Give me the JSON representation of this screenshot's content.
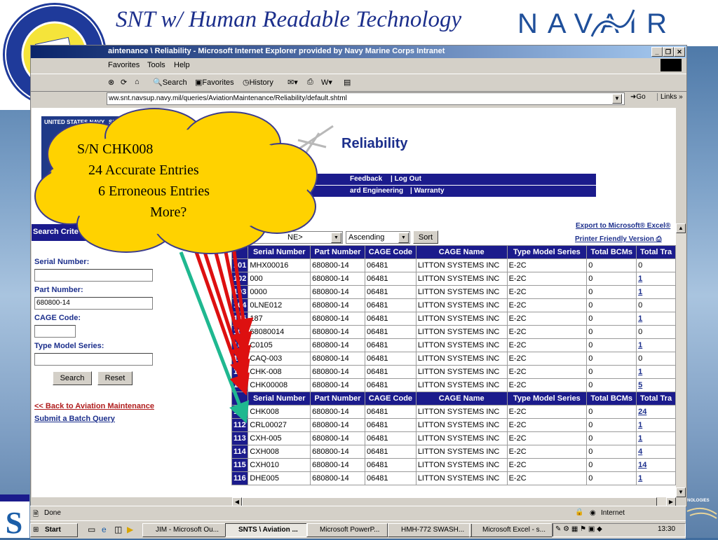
{
  "slide": {
    "title": "SNT w/ Human Readable Technology",
    "brand": "NAVAIR",
    "right_logo_text": "NOLOGIES"
  },
  "seal": {
    "top_text": "ASSISTANT SECRETARY OF THE NAVY",
    "bottom_text": "RESEARCH, DEVELOPMENT AND ACQUISITION"
  },
  "callout": {
    "line1": "S/N CHK008",
    "line2": "24 Accurate Entries",
    "line3": "6 Erroneous Entries",
    "line4": "More?"
  },
  "window": {
    "title": "aintenance \\ Reliability - Microsoft Internet Explorer provided by Navy Marine Corps Intranet",
    "menu": [
      "Favorites",
      "Tools",
      "Help"
    ],
    "toolbar": {
      "search": "Search",
      "favorites": "Favorites",
      "history": "History"
    },
    "address": "ww.snt.navsup.navy.mil/queries/AviationMaintenance/Reliability/default.shtml",
    "go": "Go",
    "links": "Links"
  },
  "page": {
    "logo_text": "UNITED STATES NAVY",
    "logo_sub": "SERI",
    "heading": "Reliability",
    "nav1": [
      "Feedback",
      "| Log Out"
    ],
    "nav2": [
      "ard Engineering",
      "| Warranty"
    ],
    "criteria_title": "Search Crite",
    "serial_label": "Serial Number:",
    "serial_value": "",
    "part_label": "Part Number:",
    "part_value": "680800-14",
    "cage_label": "CAGE Code:",
    "cage_value": "",
    "tms_label": "Type Model Series:",
    "tms_value": "",
    "search_btn": "Search",
    "reset_btn": "Reset",
    "back_link": "<< Back to Aviation Maintenance",
    "batch_link": "Submit a Batch Query",
    "sort_field": "NE>",
    "sort_order": "Ascending",
    "sort_btn": "Sort",
    "export_link": "Export to Microsoft® Excel®",
    "print_link": "Printer Friendly Version"
  },
  "table": {
    "headers": [
      "Serial Number",
      "Part Number",
      "CAGE Code",
      "CAGE Name",
      "Type Model Series",
      "Total BCMs",
      "Total Tra"
    ],
    "rows": [
      {
        "n": "101",
        "sn": "MHX00016",
        "pn": "680800-14",
        "cage": "06481",
        "name": "LITTON SYSTEMS INC",
        "tms": "E-2C",
        "bcm": "0",
        "tra": "0",
        "link": false
      },
      {
        "n": "102",
        "sn": "000",
        "pn": "680800-14",
        "cage": "06481",
        "name": "LITTON SYSTEMS INC",
        "tms": "E-2C",
        "bcm": "0",
        "tra": "1",
        "link": true
      },
      {
        "n": "103",
        "sn": "0000",
        "pn": "680800-14",
        "cage": "06481",
        "name": "LITTON SYSTEMS INC",
        "tms": "E-2C",
        "bcm": "0",
        "tra": "1",
        "link": true
      },
      {
        "n": "104",
        "sn": "0LNE012",
        "pn": "680800-14",
        "cage": "06481",
        "name": "LITTON SYSTEMS INC",
        "tms": "E-2C",
        "bcm": "0",
        "tra": "0",
        "link": false
      },
      {
        "n": "105",
        "sn": "187",
        "pn": "680800-14",
        "cage": "06481",
        "name": "LITTON SYSTEMS INC",
        "tms": "E-2C",
        "bcm": "0",
        "tra": "1",
        "link": true
      },
      {
        "n": "106",
        "sn": "68080014",
        "pn": "680800-14",
        "cage": "06481",
        "name": "LITTON SYSTEMS INC",
        "tms": "E-2C",
        "bcm": "0",
        "tra": "0",
        "link": false
      },
      {
        "n": "107",
        "sn": "C0105",
        "pn": "680800-14",
        "cage": "06481",
        "name": "LITTON SYSTEMS INC",
        "tms": "E-2C",
        "bcm": "0",
        "tra": "1",
        "link": true
      },
      {
        "n": "108",
        "sn": "CAQ-003",
        "pn": "680800-14",
        "cage": "06481",
        "name": "LITTON SYSTEMS INC",
        "tms": "E-2C",
        "bcm": "0",
        "tra": "0",
        "link": false
      },
      {
        "n": "109",
        "sn": "CHK-008",
        "pn": "680800-14",
        "cage": "06481",
        "name": "LITTON SYSTEMS INC",
        "tms": "E-2C",
        "bcm": "0",
        "tra": "1",
        "link": true
      },
      {
        "n": "110",
        "sn": "CHK00008",
        "pn": "680800-14",
        "cage": "06481",
        "name": "LITTON SYSTEMS INC",
        "tms": "E-2C",
        "bcm": "0",
        "tra": "5",
        "link": true
      },
      {
        "n": "",
        "header": true
      },
      {
        "n": "111",
        "sn": "CHK008",
        "pn": "680800-14",
        "cage": "06481",
        "name": "LITTON SYSTEMS INC",
        "tms": "E-2C",
        "bcm": "0",
        "tra": "24",
        "link": true
      },
      {
        "n": "112",
        "sn": "CRL00027",
        "pn": "680800-14",
        "cage": "06481",
        "name": "LITTON SYSTEMS INC",
        "tms": "E-2C",
        "bcm": "0",
        "tra": "1",
        "link": true
      },
      {
        "n": "113",
        "sn": "CXH-005",
        "pn": "680800-14",
        "cage": "06481",
        "name": "LITTON SYSTEMS INC",
        "tms": "E-2C",
        "bcm": "0",
        "tra": "1",
        "link": true
      },
      {
        "n": "114",
        "sn": "CXH008",
        "pn": "680800-14",
        "cage": "06481",
        "name": "LITTON SYSTEMS INC",
        "tms": "E-2C",
        "bcm": "0",
        "tra": "4",
        "link": true
      },
      {
        "n": "115",
        "sn": "CXH010",
        "pn": "680800-14",
        "cage": "06481",
        "name": "LITTON SYSTEMS INC",
        "tms": "E-2C",
        "bcm": "0",
        "tra": "14",
        "link": true
      },
      {
        "n": "116",
        "sn": "DHE005",
        "pn": "680800-14",
        "cage": "06481",
        "name": "LITTON SYSTEMS INC",
        "tms": "E-2C",
        "bcm": "0",
        "tra": "1",
        "link": true
      }
    ]
  },
  "status": {
    "text": "Done",
    "zone": "Internet"
  },
  "taskbar": {
    "start": "Start",
    "items": [
      {
        "label": "JIM - Microsoft Ou...",
        "active": false
      },
      {
        "label": "SNTS \\ Aviation ...",
        "active": true
      },
      {
        "label": "Microsoft PowerP...",
        "active": false
      },
      {
        "label": "HMH-772 SWASH...",
        "active": false
      },
      {
        "label": "Microsoft Excel - s...",
        "active": false
      }
    ],
    "clock": "13:30"
  },
  "colors": {
    "header_navy": "#1b1b8c",
    "title_blue": "#1c2f8c",
    "arrow_red": "#dd1010",
    "arrow_green": "#1fb890",
    "cloud_fill": "#ffd200"
  }
}
